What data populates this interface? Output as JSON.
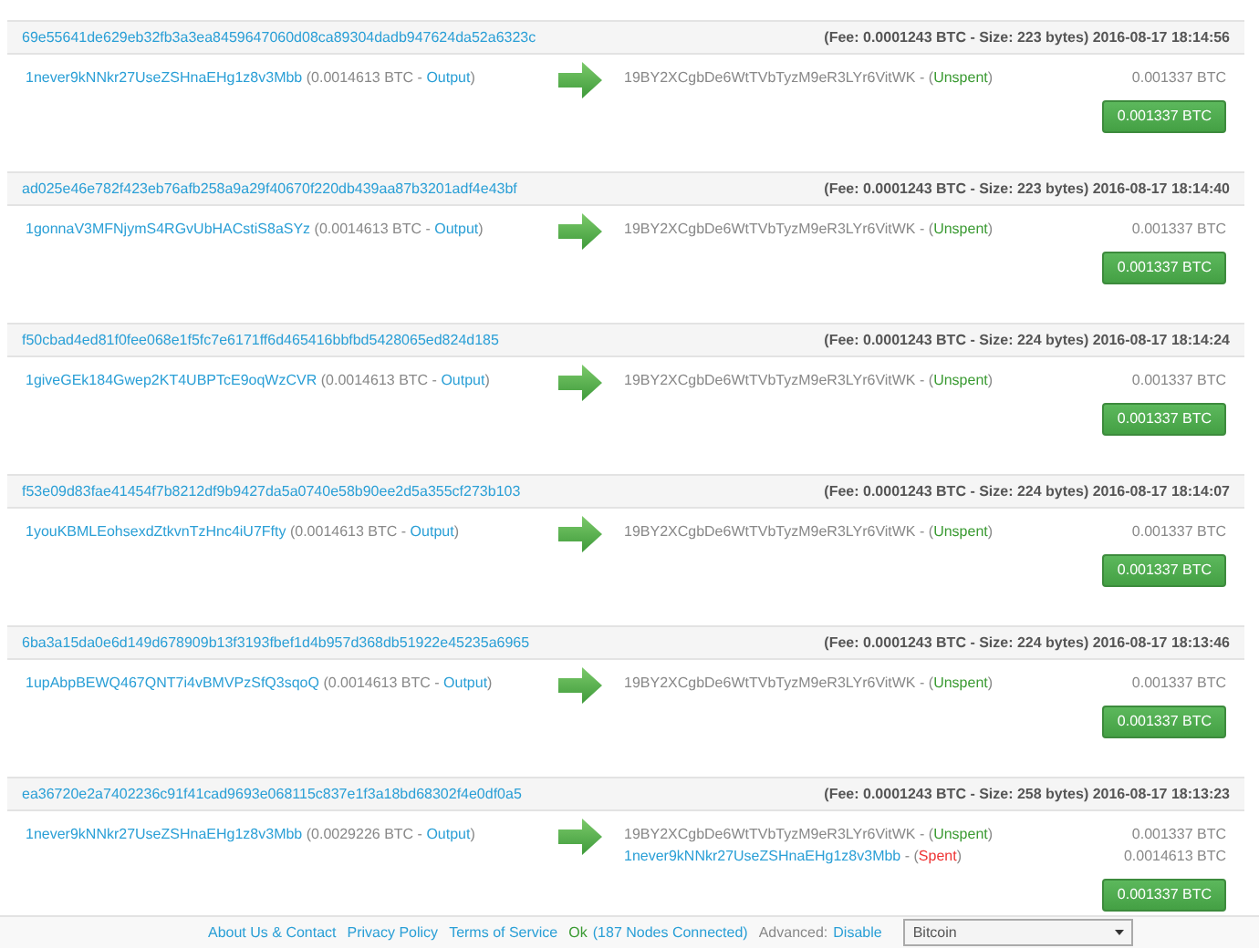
{
  "transactions": [
    {
      "hash": "69e55641de629eb32fb3a3ea8459647060d08ca89304dadb947624da52a6323c",
      "meta": "(Fee: 0.0001243 BTC - Size: 223 bytes) 2016-08-17 18:14:56",
      "input": {
        "address": "1never9kNNkr27UseZSHnaEHg1z8v3Mbb",
        "amount": "(0.0014613 BTC -",
        "type": "Output",
        "close": ")"
      },
      "outputs": [
        {
          "address": "19BY2XCgbDe6WtTVbTyzM9eR3LYr6VitWK",
          "link": false,
          "prefix": "- (",
          "status": "Unspent",
          "spent": false,
          "close": ")",
          "amount": "0.001337 BTC"
        }
      ],
      "total": "0.001337 BTC"
    },
    {
      "hash": "ad025e46e782f423eb76afb258a9a29f40670f220db439aa87b3201adf4e43bf",
      "meta": "(Fee: 0.0001243 BTC - Size: 223 bytes) 2016-08-17 18:14:40",
      "input": {
        "address": "1gonnaV3MFNjymS4RGvUbHACstiS8aSYz",
        "amount": "(0.0014613 BTC -",
        "type": "Output",
        "close": ")"
      },
      "outputs": [
        {
          "address": "19BY2XCgbDe6WtTVbTyzM9eR3LYr6VitWK",
          "link": false,
          "prefix": "- (",
          "status": "Unspent",
          "spent": false,
          "close": ")",
          "amount": "0.001337 BTC"
        }
      ],
      "total": "0.001337 BTC"
    },
    {
      "hash": "f50cbad4ed81f0fee068e1f5fc7e6171ff6d465416bbfbd5428065ed824d185",
      "meta": "(Fee: 0.0001243 BTC - Size: 224 bytes) 2016-08-17 18:14:24",
      "input": {
        "address": "1giveGEk184Gwep2KT4UBPTcE9oqWzCVR",
        "amount": "(0.0014613 BTC -",
        "type": "Output",
        "close": ")"
      },
      "outputs": [
        {
          "address": "19BY2XCgbDe6WtTVbTyzM9eR3LYr6VitWK",
          "link": false,
          "prefix": "- (",
          "status": "Unspent",
          "spent": false,
          "close": ")",
          "amount": "0.001337 BTC"
        }
      ],
      "total": "0.001337 BTC"
    },
    {
      "hash": "f53e09d83fae41454f7b8212df9b9427da5a0740e58b90ee2d5a355cf273b103",
      "meta": "(Fee: 0.0001243 BTC - Size: 224 bytes) 2016-08-17 18:14:07",
      "input": {
        "address": "1youKBMLEohsexdZtkvnTzHnc4iU7Ffty",
        "amount": "(0.0014613 BTC -",
        "type": "Output",
        "close": ")"
      },
      "outputs": [
        {
          "address": "19BY2XCgbDe6WtTVbTyzM9eR3LYr6VitWK",
          "link": false,
          "prefix": "- (",
          "status": "Unspent",
          "spent": false,
          "close": ")",
          "amount": "0.001337 BTC"
        }
      ],
      "total": "0.001337 BTC"
    },
    {
      "hash": "6ba3a15da0e6d149d678909b13f3193fbef1d4b957d368db51922e45235a6965",
      "meta": "(Fee: 0.0001243 BTC - Size: 224 bytes) 2016-08-17 18:13:46",
      "input": {
        "address": "1upAbpBEWQ467QNT7i4vBMVPzSfQ3sqoQ",
        "amount": "(0.0014613 BTC -",
        "type": "Output",
        "close": ")"
      },
      "outputs": [
        {
          "address": "19BY2XCgbDe6WtTVbTyzM9eR3LYr6VitWK",
          "link": false,
          "prefix": "- (",
          "status": "Unspent",
          "spent": false,
          "close": ")",
          "amount": "0.001337 BTC"
        }
      ],
      "total": "0.001337 BTC"
    },
    {
      "hash": "ea36720e2a7402236c91f41cad9693e068115c837e1f3a18bd68302f4e0df0a5",
      "meta": "(Fee: 0.0001243 BTC - Size: 258 bytes) 2016-08-17 18:13:23",
      "input": {
        "address": "1never9kNNkr27UseZSHnaEHg1z8v3Mbb",
        "amount": "(0.0029226 BTC -",
        "type": "Output",
        "close": ")"
      },
      "outputs": [
        {
          "address": "19BY2XCgbDe6WtTVbTyzM9eR3LYr6VitWK",
          "link": false,
          "prefix": "- (",
          "status": "Unspent",
          "spent": false,
          "close": ")",
          "amount": "0.001337 BTC"
        },
        {
          "address": "1never9kNNkr27UseZSHnaEHg1z8v3Mbb",
          "link": true,
          "prefix": "- (",
          "status": "Spent",
          "spent": true,
          "close": ")",
          "amount": "0.0014613 BTC"
        }
      ],
      "total": "0.001337 BTC"
    }
  ],
  "footer": {
    "links": [
      "About Us & Contact",
      "Privacy Policy",
      "Terms of Service"
    ],
    "status": "Ok",
    "nodes": "(187 Nodes Connected)",
    "advanced_label": "Advanced:",
    "advanced_link": "Disable",
    "network": "Bitcoin"
  }
}
